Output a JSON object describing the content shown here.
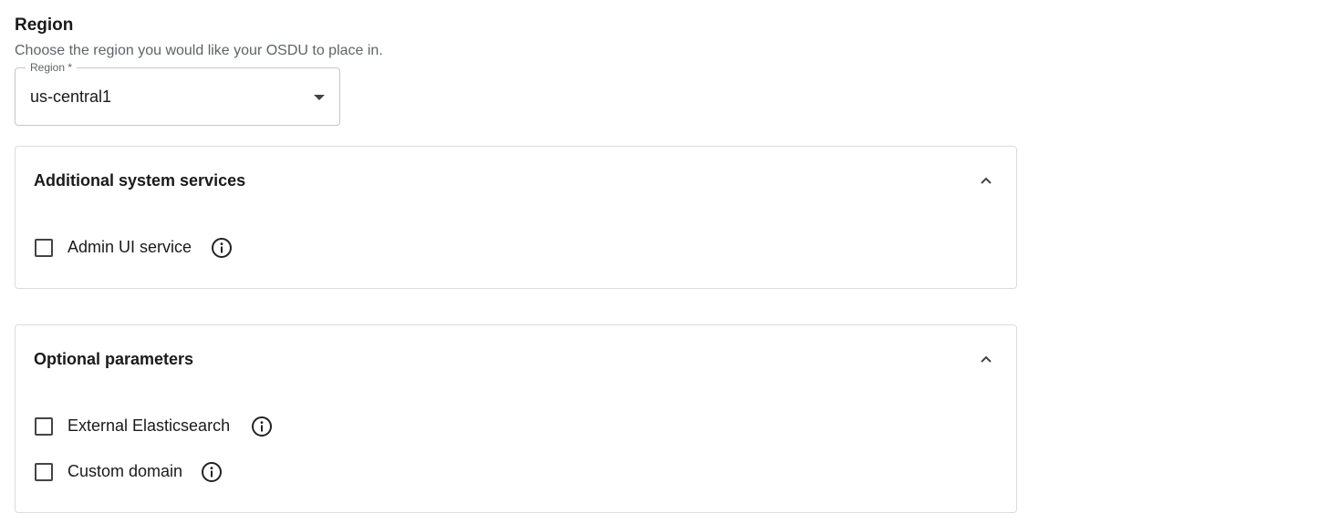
{
  "region": {
    "title": "Region",
    "description": "Choose the region you would like your OSDU to place in.",
    "select": {
      "label": "Region *",
      "value": "us-central1"
    }
  },
  "panels": [
    {
      "title": "Additional system services",
      "expanded": true,
      "options": [
        {
          "label": "Admin UI service",
          "checked": false,
          "icon": "info-icon"
        }
      ]
    },
    {
      "title": "Optional parameters",
      "expanded": true,
      "options": [
        {
          "label": "External Elasticsearch",
          "checked": false,
          "icon": "info-icon"
        },
        {
          "label": "Custom domain",
          "checked": false,
          "icon": "info-icon"
        }
      ]
    }
  ]
}
